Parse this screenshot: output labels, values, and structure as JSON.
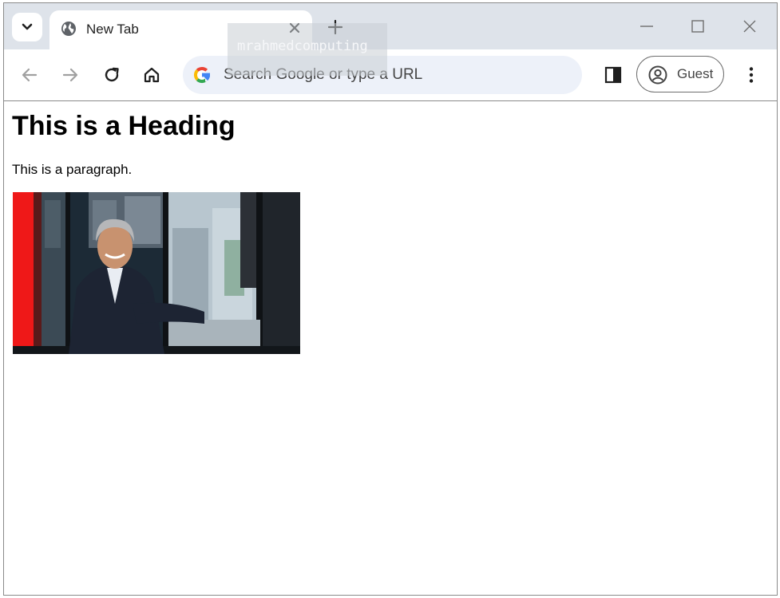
{
  "browser": {
    "tab": {
      "title": "New Tab",
      "icon": "globe-icon"
    },
    "omnibox": {
      "placeholder": "Search Google or type a URL"
    },
    "profile": {
      "label": "Guest"
    },
    "watermark": "mrahmedcomputing"
  },
  "page": {
    "heading": "This is a Heading",
    "paragraph": "This is a paragraph."
  },
  "colors": {
    "tabstrip": "#dee3ea",
    "omnibox": "#edf1f9",
    "bus_red": "#ef1818"
  }
}
